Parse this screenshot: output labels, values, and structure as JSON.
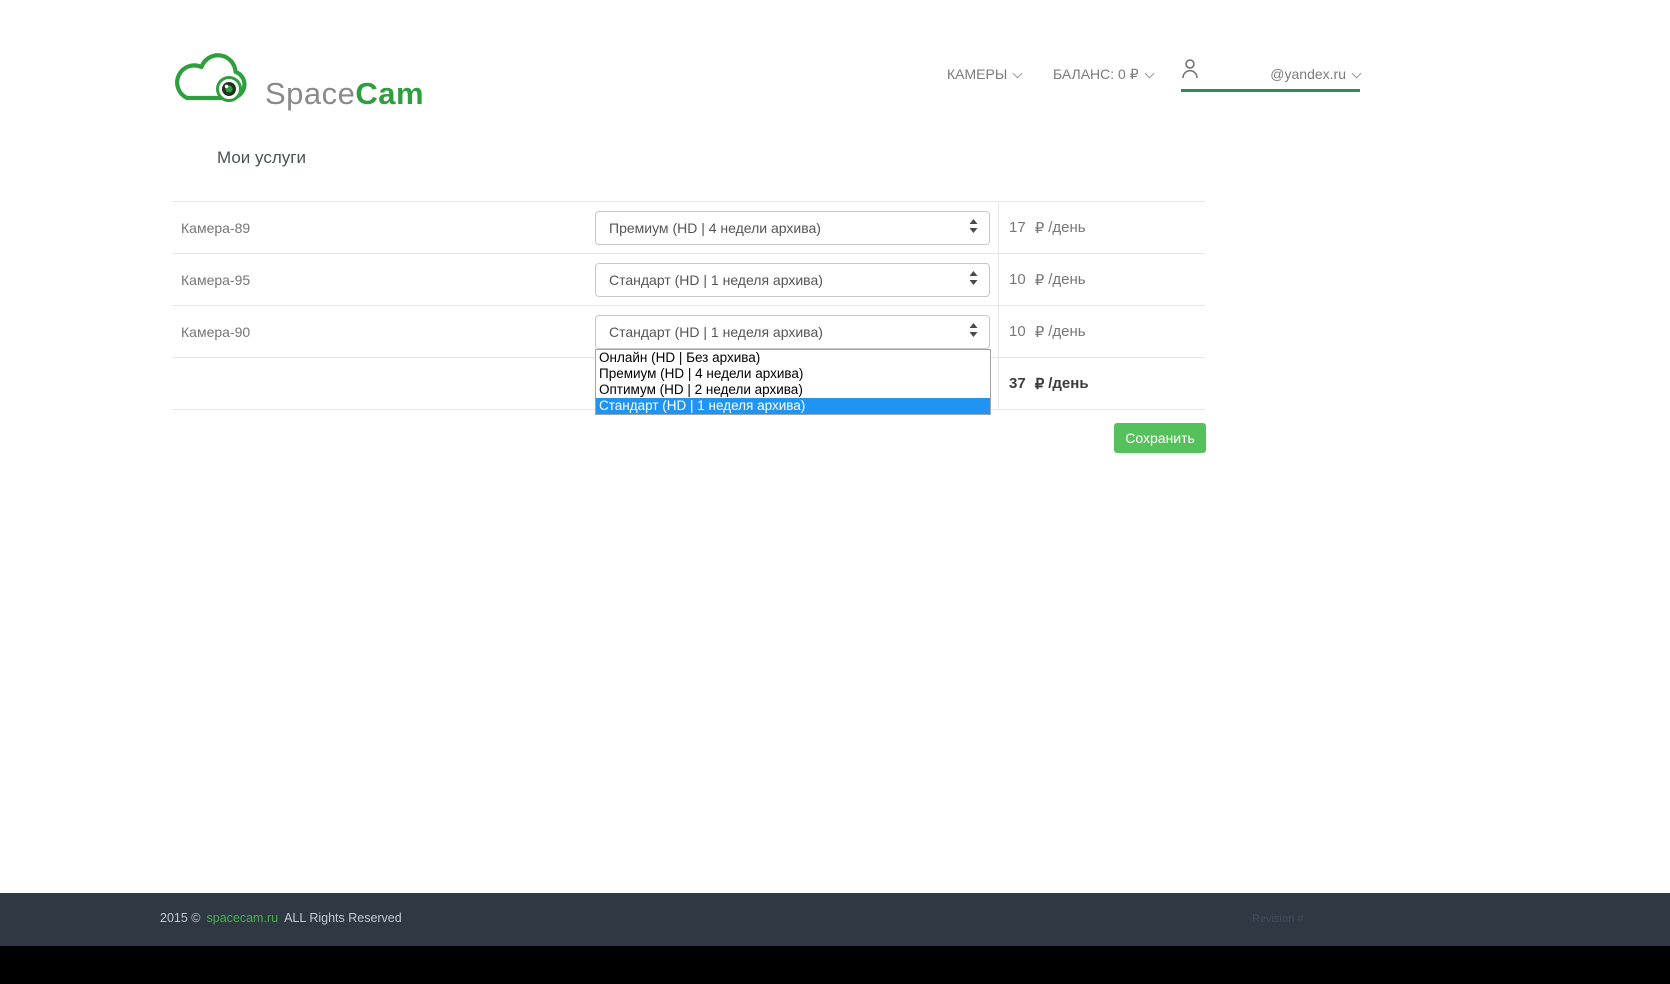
{
  "brand": {
    "name_gray": "Space",
    "name_green": "Cam"
  },
  "nav": {
    "cameras_label": "КАМЕРЫ",
    "balance_label": "БАЛАНС: 0 ₽",
    "account_label": "@yandex.ru"
  },
  "page": {
    "title": "Мои услуги"
  },
  "services": {
    "rows": [
      {
        "name": "Камера-89",
        "plan": "Премиум (HD | 4 недели архива)",
        "price": "17",
        "currency": "₽",
        "unit": "/день"
      },
      {
        "name": "Камера-95",
        "plan": "Стандарт (HD | 1 неделя архива)",
        "price": "10",
        "currency": "₽",
        "unit": "/день"
      },
      {
        "name": "Камера-90",
        "plan": "Стандарт (HD | 1 неделя архива)",
        "price": "10",
        "currency": "₽",
        "unit": "/день"
      }
    ],
    "total": {
      "price": "37",
      "currency": "₽",
      "unit": "/день"
    },
    "dropdown": {
      "options": [
        "Онлайн (HD | Без архива)",
        "Премиум (HD | 4 недели архива)",
        "Оптимум (HD | 2 недели архива)",
        "Стандарт (HD | 1 неделя архива)"
      ],
      "selected_index": 3
    },
    "save_label": "Сохранить"
  },
  "footer": {
    "year": "2015 ©",
    "site_link": "spacecam.ru",
    "rights": "ALL Rights Reserved",
    "revision": "Revision #"
  },
  "colors": {
    "brand_green": "#2f9e3f",
    "button_green": "#56c15c",
    "account_underline_green": "#2e8b4f",
    "footer_link_green": "#4cae4c",
    "option_highlight_blue": "#2094f3",
    "footer_bg": "#2e3944"
  }
}
